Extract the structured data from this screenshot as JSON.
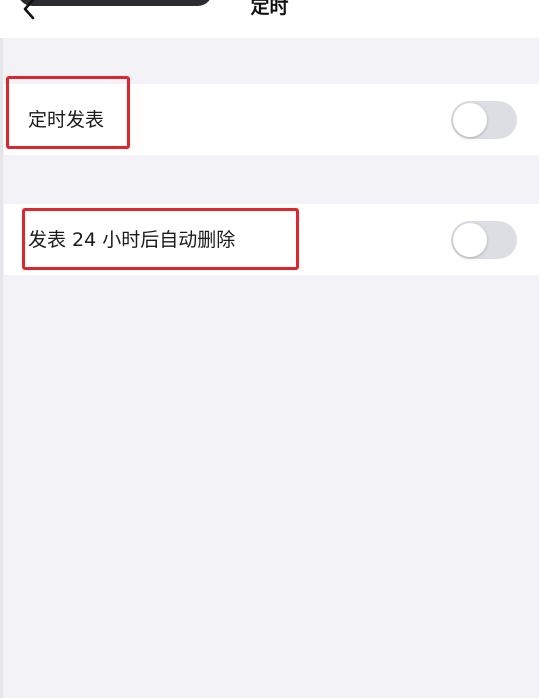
{
  "nav": {
    "title": "定时",
    "back_icon": "chevron-left-icon"
  },
  "settings": [
    {
      "label": "定时发表",
      "enabled": false
    },
    {
      "label": "发表 24 小时后自动删除",
      "enabled": false
    }
  ],
  "colors": {
    "background": "#f3f3f7",
    "row_background": "#ffffff",
    "toggle_off": "#dddde4",
    "highlight_red": "#e0262d"
  }
}
